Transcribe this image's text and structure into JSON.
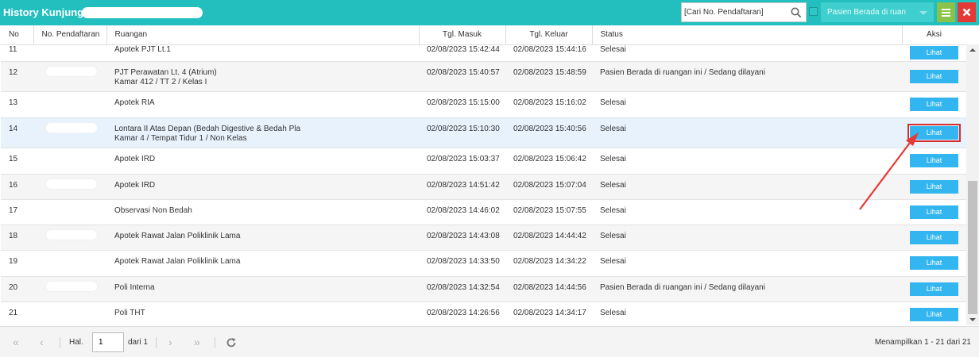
{
  "header": {
    "title": "History Kunjungan",
    "search_placeholder": "[Cari No. Pendaftaran]",
    "filter_selected": "Pasien Berada di ruan",
    "accent_color": "#22bfbe"
  },
  "table": {
    "columns": [
      "No",
      "No. Pendaftaran",
      "Ruangan",
      "Tgl. Masuk",
      "Tgl. Keluar",
      "Status",
      "Aksi"
    ],
    "action_label": "Lihat",
    "rows": [
      {
        "no": "11",
        "ruangan": "Apotek PJT Lt.1",
        "ruangan2": "",
        "masuk": "02/08/2023 15:42:44",
        "keluar": "02/08/2023 15:44:16",
        "status": "Selesai",
        "redacted": false
      },
      {
        "no": "12",
        "ruangan": "PJT Perawatan Lt. 4 (Atrium)",
        "ruangan2": "Kamar 412 / TT 2 / Kelas I",
        "masuk": "02/08/2023 15:40:57",
        "keluar": "02/08/2023 15:48:59",
        "status": "Pasien Berada di ruangan ini / Sedang dilayani",
        "redacted": true
      },
      {
        "no": "13",
        "ruangan": "Apotek RIA",
        "ruangan2": "",
        "masuk": "02/08/2023 15:15:00",
        "keluar": "02/08/2023 15:16:02",
        "status": "Selesai",
        "redacted": false
      },
      {
        "no": "14",
        "ruangan": "Lontara II Atas Depan (Bedah Digestive & Bedah Pla",
        "ruangan2": "Kamar 4 / Tempat Tidur 1 / Non Kelas",
        "masuk": "02/08/2023 15:10:30",
        "keluar": "02/08/2023 15:40:56",
        "status": "Selesai",
        "redacted": true
      },
      {
        "no": "15",
        "ruangan": "Apotek IRD",
        "ruangan2": "",
        "masuk": "02/08/2023 15:03:37",
        "keluar": "02/08/2023 15:06:42",
        "status": "Selesai",
        "redacted": false
      },
      {
        "no": "16",
        "ruangan": "Apotek IRD",
        "ruangan2": "",
        "masuk": "02/08/2023 14:51:42",
        "keluar": "02/08/2023 15:07:04",
        "status": "Selesai",
        "redacted": true
      },
      {
        "no": "17",
        "ruangan": "Observasi Non Bedah",
        "ruangan2": "",
        "masuk": "02/08/2023 14:46:02",
        "keluar": "02/08/2023 15:07:55",
        "status": "Selesai",
        "redacted": false
      },
      {
        "no": "18",
        "ruangan": "Apotek Rawat Jalan Poliklinik Lama",
        "ruangan2": "",
        "masuk": "02/08/2023 14:43:08",
        "keluar": "02/08/2023 14:44:42",
        "status": "Selesai",
        "redacted": true
      },
      {
        "no": "19",
        "ruangan": "Apotek Rawat Jalan Poliklinik Lama",
        "ruangan2": "",
        "masuk": "02/08/2023 14:33:50",
        "keluar": "02/08/2023 14:34:22",
        "status": "Selesai",
        "redacted": false
      },
      {
        "no": "20",
        "ruangan": "Poli Interna",
        "ruangan2": "",
        "masuk": "02/08/2023 14:32:54",
        "keluar": "02/08/2023 14:44:56",
        "status": "Pasien Berada di ruangan ini / Sedang dilayani",
        "redacted": true
      },
      {
        "no": "21",
        "ruangan": "Poli THT",
        "ruangan2": "",
        "masuk": "02/08/2023 14:26:56",
        "keluar": "02/08/2023 14:34:17",
        "status": "Selesai",
        "redacted": false
      }
    ]
  },
  "pager": {
    "page_label": "Hal.",
    "page_value": "1",
    "of_label": "dari 1",
    "info": "Menampilkan 1 - 21 dari 21"
  }
}
